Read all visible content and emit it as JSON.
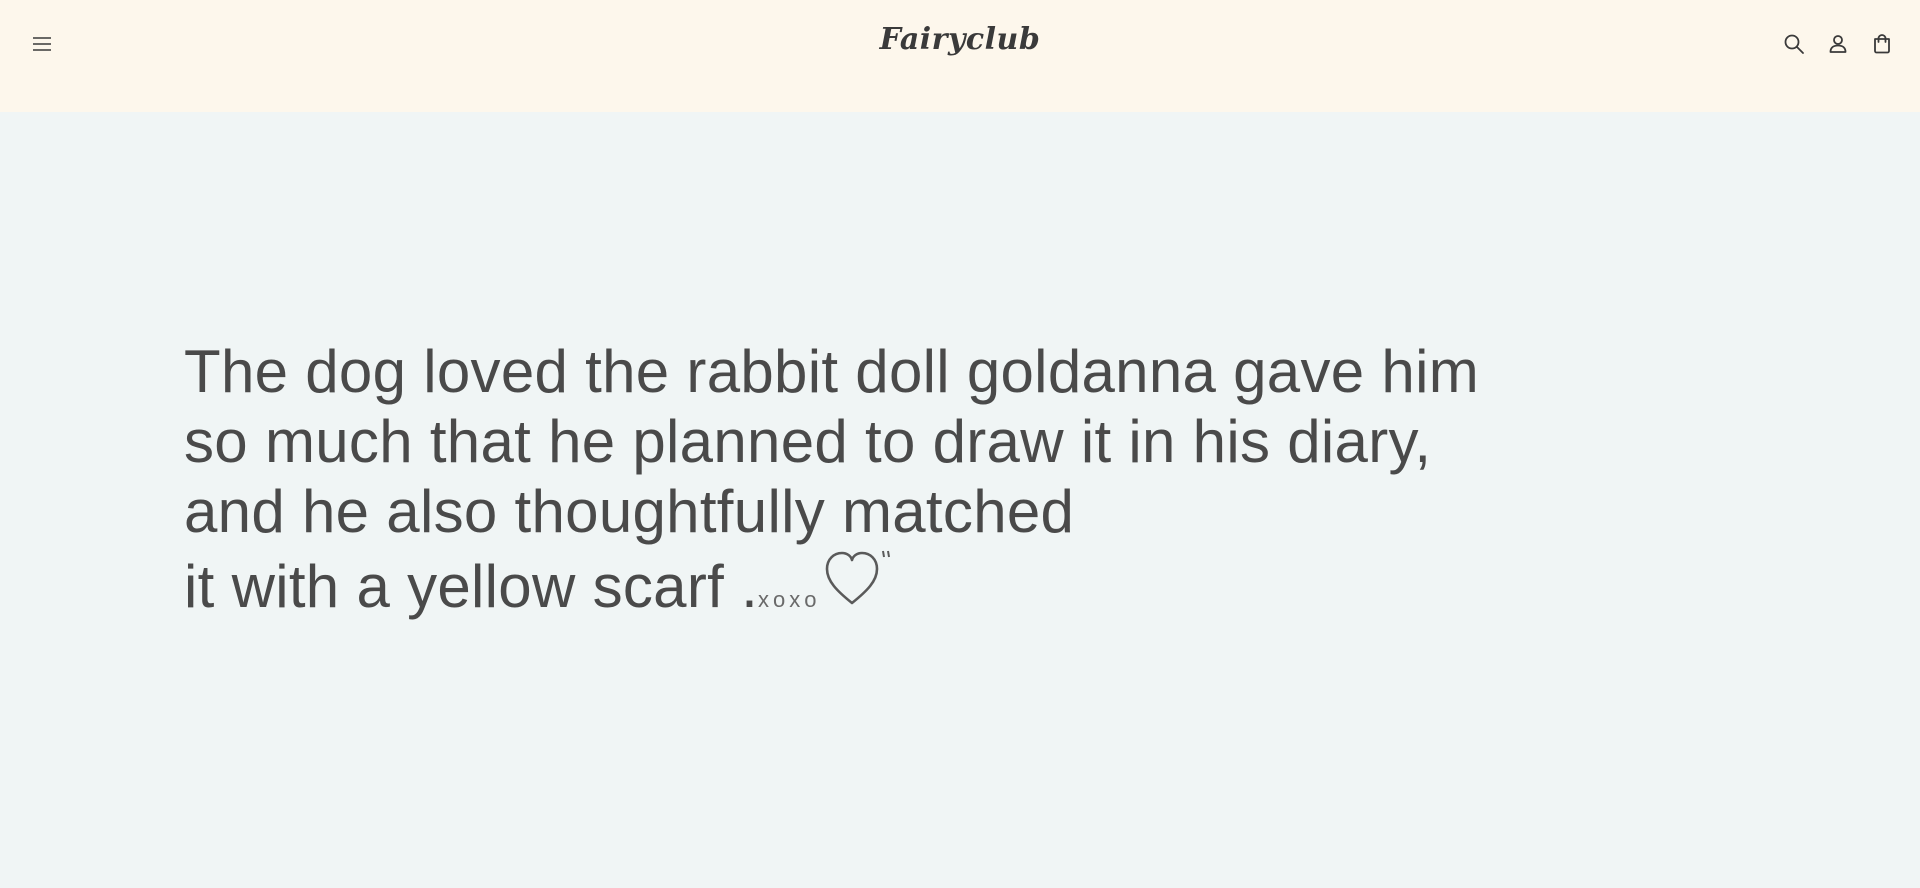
{
  "header": {
    "logo": "Fairyclub",
    "menu_icon": "hamburger-menu-icon",
    "search_icon": "search-icon",
    "account_icon": "user-icon",
    "cart_icon": "cart-icon"
  },
  "banner": {
    "lines": [
      "The dog loved the rabbit doll goldanna gave him",
      "so much that he planned to draw it in his diary,",
      "and he also thoughtfully matched",
      "it with a yellow scarf ."
    ],
    "xoxo": "xoxo",
    "heart_icon": "heart-icon"
  },
  "colors": {
    "header_bg": "#fdf7ec",
    "banner_bg": "#f0f5f5",
    "text": "#4a4a4a"
  }
}
